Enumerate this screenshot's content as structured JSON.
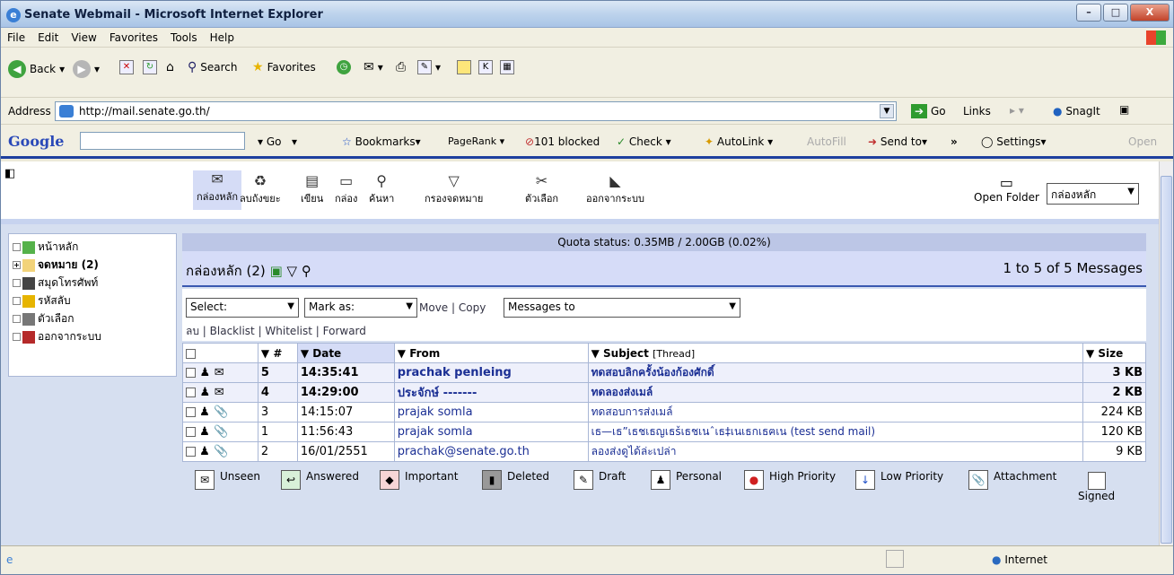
{
  "window": {
    "title": "Senate Webmail - Microsoft Internet Explorer",
    "controls": [
      "–",
      "□",
      "X"
    ]
  },
  "menu": [
    "File",
    "Edit",
    "View",
    "Favorites",
    "Tools",
    "Help"
  ],
  "toolbar": {
    "back": "Back",
    "search": "Search",
    "favorites": "Favorites"
  },
  "address": {
    "label": "Address",
    "url": "http://mail.senate.go.th/",
    "go": "Go",
    "links": "Links",
    "snagit": "SnagIt"
  },
  "google": {
    "logo": "Google",
    "go": "Go",
    "bookmarks": "Bookmarks",
    "pagerank": "PageRank",
    "blocked": "101 blocked",
    "check": "Check",
    "autolink": "AutoLink",
    "autofill": "AutoFill",
    "sendto": "Send to",
    "settings": "Settings",
    "open": "Open"
  },
  "nav": {
    "items": [
      "กล่องหลัก",
      "ลบถังขยะ",
      "เขียน",
      "กล่อง",
      "ค้นหา",
      "กรองจดหมาย",
      "ตัวเลือก",
      "ออกจากระบบ"
    ],
    "open_folder": "Open Folder",
    "mailbox_select": "กล่องหลัก"
  },
  "folders": [
    {
      "label": "หน้าหลัก",
      "expander": ""
    },
    {
      "label": "จดหมาย (2)",
      "expander": "+"
    },
    {
      "label": "สมุดโทรศัพท์",
      "expander": ""
    },
    {
      "label": "รหัสลับ",
      "expander": ""
    },
    {
      "label": "ตัวเลือก",
      "expander": ""
    },
    {
      "label": "ออกจากระบบ",
      "expander": ""
    }
  ],
  "quota": "Quota status: 0.35MB / 2.00GB (0.02%)",
  "mailbox": {
    "title": "กล่องหลัก (2)",
    "count": "1 to 5 of 5 Messages"
  },
  "actions": {
    "select": "Select:",
    "mark_as": "Mark as:",
    "move": "Move",
    "copy": "Copy",
    "messages_to": "Messages to",
    "delete": "ลบ",
    "blacklist": "Blacklist",
    "whitelist": "Whitelist",
    "forward": "Forward"
  },
  "columns": {
    "num": "▼ #",
    "date": "▼ Date",
    "from": "▼ From",
    "subject": "▼ Subject",
    "thread": "[Thread]",
    "size": "▼ Size"
  },
  "messages": [
    {
      "num": "5",
      "date": "14:35:41",
      "from": "prachak penleing",
      "subject": "ทดสอบลิกครั้งน้องก้องศักดิ์",
      "size": "3 KB",
      "icon": "✉",
      "new": true
    },
    {
      "num": "4",
      "date": "14:29:00",
      "from": "ประจักษ์ -------",
      "subject": "ทดลองส่งเมล์",
      "size": "2 KB",
      "icon": "✉",
      "new": true
    },
    {
      "num": "3",
      "date": "14:15:07",
      "from": "prajak somla",
      "subject": "ทดสอบการส่งเมล์",
      "size": "224 KB",
      "icon": "📎",
      "new": false
    },
    {
      "num": "1",
      "date": "11:56:43",
      "from": "prajak somla",
      "subject": "เธ—เธ”เธชเธญเธšเธชเนˆเธ‡เนเธกเธฅเน (test send mail)",
      "size": "120 KB",
      "icon": "📎",
      "new": false
    },
    {
      "num": "2",
      "date": "16/01/2551",
      "from": "prachak@senate.go.th",
      "subject": "ลองส่งดูได้ล่ะเปล่า",
      "size": "9 KB",
      "icon": "📎",
      "new": false
    }
  ],
  "legend": [
    "Unseen",
    "Answered",
    "Important",
    "Deleted",
    "Draft",
    "Personal",
    "High Priority",
    "Low Priority",
    "Attachment",
    "Signed"
  ],
  "status": {
    "zone": "Internet"
  }
}
